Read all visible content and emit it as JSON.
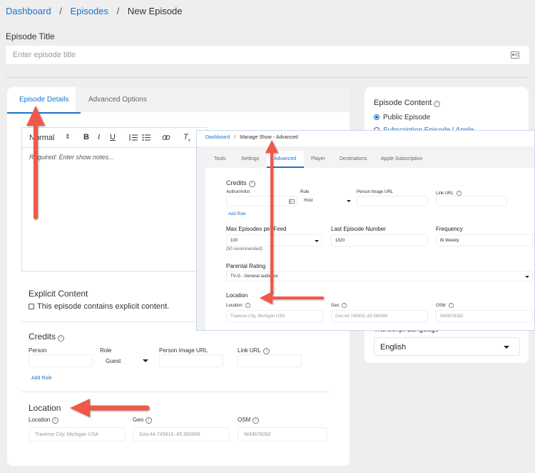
{
  "breadcrumb": {
    "dashboard": "Dashboard",
    "episodes": "Episodes",
    "current": "New Episode",
    "sep": "/"
  },
  "episode_title": {
    "label": "Episode Title",
    "placeholder": "Enter episode title"
  },
  "tabs": {
    "details": "Episode Details",
    "advanced": "Advanced Options"
  },
  "toolbar": {
    "format": "Normal",
    "bold": "B",
    "italic": "I",
    "underline": "U"
  },
  "editor": {
    "placeholder": "Required: Enter show notes..."
  },
  "explicit": {
    "title": "Explicit Content",
    "checkbox_label": "This episode contains explicit content."
  },
  "credits": {
    "title": "Credits",
    "person": "Person",
    "role": "Role",
    "person_image_url": "Person Image URL",
    "link_url": "Link URL",
    "role_value": "Guest",
    "add_role": "Add Role"
  },
  "location": {
    "title": "Location",
    "location_label": "Location",
    "geo_label": "Geo",
    "osm_label": "OSM",
    "location_value": "Traverse City, Michigan USA",
    "geo_value": "Geo:44.745816,-85.560699",
    "osm_value": "W43678282"
  },
  "episode_content": {
    "title": "Episode Content",
    "public": "Public Episode",
    "subscription": "Subscription Episode | Apple"
  },
  "transcript": {
    "label": "Transcript Language",
    "value": "English"
  },
  "overlay": {
    "breadcrumb": {
      "dashboard": "Dashboard",
      "sep": "/",
      "current": "Manage Show - Advanced"
    },
    "tabs": [
      "Tools",
      "Settings",
      "Advanced",
      "Player",
      "Destinations",
      "Apple Subscription"
    ],
    "credits": {
      "title": "Credits",
      "author": "Author/Artist",
      "role": "Role",
      "person_image_url": "Person Image URL",
      "link_url": "Link URL",
      "role_value": "Host",
      "add_role": "Add Role"
    },
    "max_episodes": {
      "label": "Max Episodes per Feed",
      "value": "100",
      "hint": "(50 recommended)"
    },
    "last_episode": {
      "label": "Last Episode Number",
      "value": "1620"
    },
    "frequency": {
      "label": "Frequency",
      "value": "Bi Weekly"
    },
    "parental": {
      "label": "Parental Rating",
      "value": "TV-G - General audience"
    },
    "location": {
      "title": "Location",
      "location_label": "Location",
      "geo_label": "Geo",
      "osm_label": "OSM",
      "location_value": "Traverse City, Michigan USA",
      "geo_value": "Geo:44.745816,-85.560699",
      "osm_value": "W43678282"
    }
  },
  "colors": {
    "accent": "#1a73c8",
    "arrow": "#f0594a",
    "background": "#eeeeee"
  }
}
